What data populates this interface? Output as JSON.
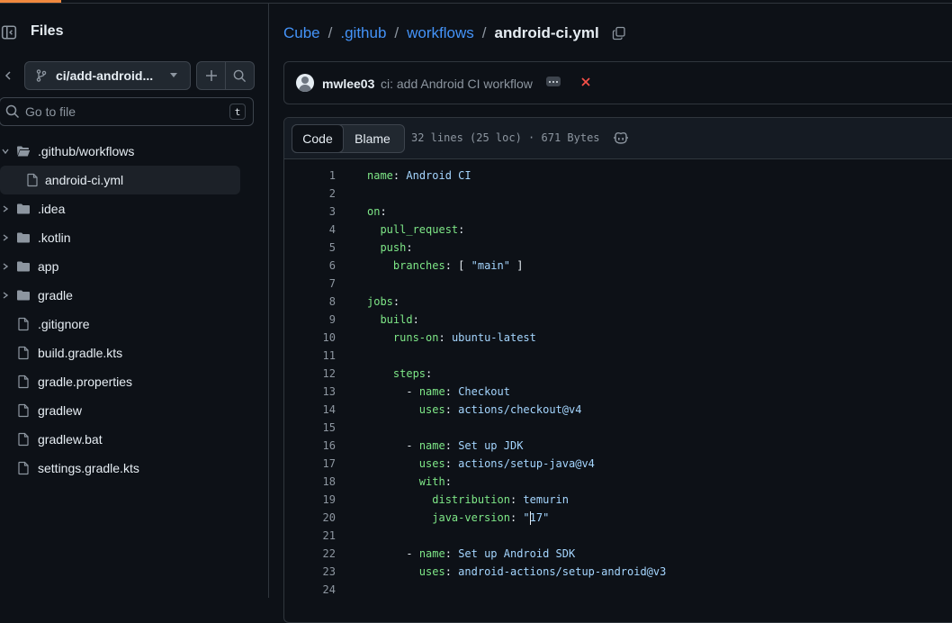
{
  "sidebar": {
    "title": "Files",
    "branch": "ci/add-android...",
    "go_to_file_placeholder": "Go to file",
    "go_to_file_shortcut": "t",
    "tree": [
      {
        "label": ".github/workflows",
        "type": "folder-open",
        "expanded": true
      },
      {
        "label": "android-ci.yml",
        "type": "file",
        "selected": true
      },
      {
        "label": ".idea",
        "type": "folder"
      },
      {
        "label": ".kotlin",
        "type": "folder"
      },
      {
        "label": "app",
        "type": "folder"
      },
      {
        "label": "gradle",
        "type": "folder"
      },
      {
        "label": ".gitignore",
        "type": "file"
      },
      {
        "label": "build.gradle.kts",
        "type": "file"
      },
      {
        "label": "gradle.properties",
        "type": "file"
      },
      {
        "label": "gradlew",
        "type": "file"
      },
      {
        "label": "gradlew.bat",
        "type": "file"
      },
      {
        "label": "settings.gradle.kts",
        "type": "file"
      }
    ]
  },
  "breadcrumb": {
    "items": [
      "Cube",
      ".github",
      "workflows"
    ],
    "current": "android-ci.yml"
  },
  "commit": {
    "author": "mwlee03",
    "message": "ci: add Android CI workflow",
    "status": "failed"
  },
  "file": {
    "tabs": [
      "Code",
      "Blame"
    ],
    "active_tab": "Code",
    "meta": "32 lines (25 loc) · 671 Bytes"
  },
  "code_lines": [
    {
      "n": "1",
      "key": "name",
      "val": "Android CI",
      "indent": ""
    },
    {
      "n": "2",
      "indent": ""
    },
    {
      "n": "3",
      "key": "on",
      "val": "",
      "indent": ""
    },
    {
      "n": "4",
      "key": "pull_request",
      "val": "",
      "indent": "  "
    },
    {
      "n": "5",
      "key": "push",
      "val": "",
      "indent": "  "
    },
    {
      "n": "6",
      "key": "branches",
      "val": "[ \"main\" ]",
      "indent": "    "
    },
    {
      "n": "7",
      "indent": ""
    },
    {
      "n": "8",
      "key": "jobs",
      "val": "",
      "indent": ""
    },
    {
      "n": "9",
      "key": "build",
      "val": "",
      "indent": "  "
    },
    {
      "n": "10",
      "key": "runs-on",
      "val": "ubuntu-latest",
      "indent": "    "
    },
    {
      "n": "11",
      "indent": ""
    },
    {
      "n": "12",
      "key": "steps",
      "val": "",
      "indent": "    "
    },
    {
      "n": "13",
      "dash": true,
      "key": "name",
      "val": "Checkout",
      "indent": "      "
    },
    {
      "n": "14",
      "key": "uses",
      "val": "actions/checkout@v4",
      "indent": "        "
    },
    {
      "n": "15",
      "indent": ""
    },
    {
      "n": "16",
      "dash": true,
      "key": "name",
      "val": "Set up JDK",
      "indent": "      "
    },
    {
      "n": "17",
      "key": "uses",
      "val": "actions/setup-java@v4",
      "indent": "        "
    },
    {
      "n": "18",
      "key": "with",
      "val": "",
      "indent": "        "
    },
    {
      "n": "19",
      "key": "distribution",
      "val": "temurin",
      "indent": "          "
    },
    {
      "n": "20",
      "key": "java-version",
      "val": "\"17\"",
      "indent": "          ",
      "cursor_after": 1
    },
    {
      "n": "21",
      "indent": ""
    },
    {
      "n": "22",
      "dash": true,
      "key": "name",
      "val": "Set up Android SDK",
      "indent": "      "
    },
    {
      "n": "23",
      "key": "uses",
      "val": "android-actions/setup-android@v3",
      "indent": "        "
    },
    {
      "n": "24",
      "indent": ""
    }
  ],
  "colors": {
    "accent": "#4493f8",
    "key": "#7ee787",
    "string": "#a5d6ff",
    "error": "#f85149",
    "top_tab": "#f0883e"
  }
}
